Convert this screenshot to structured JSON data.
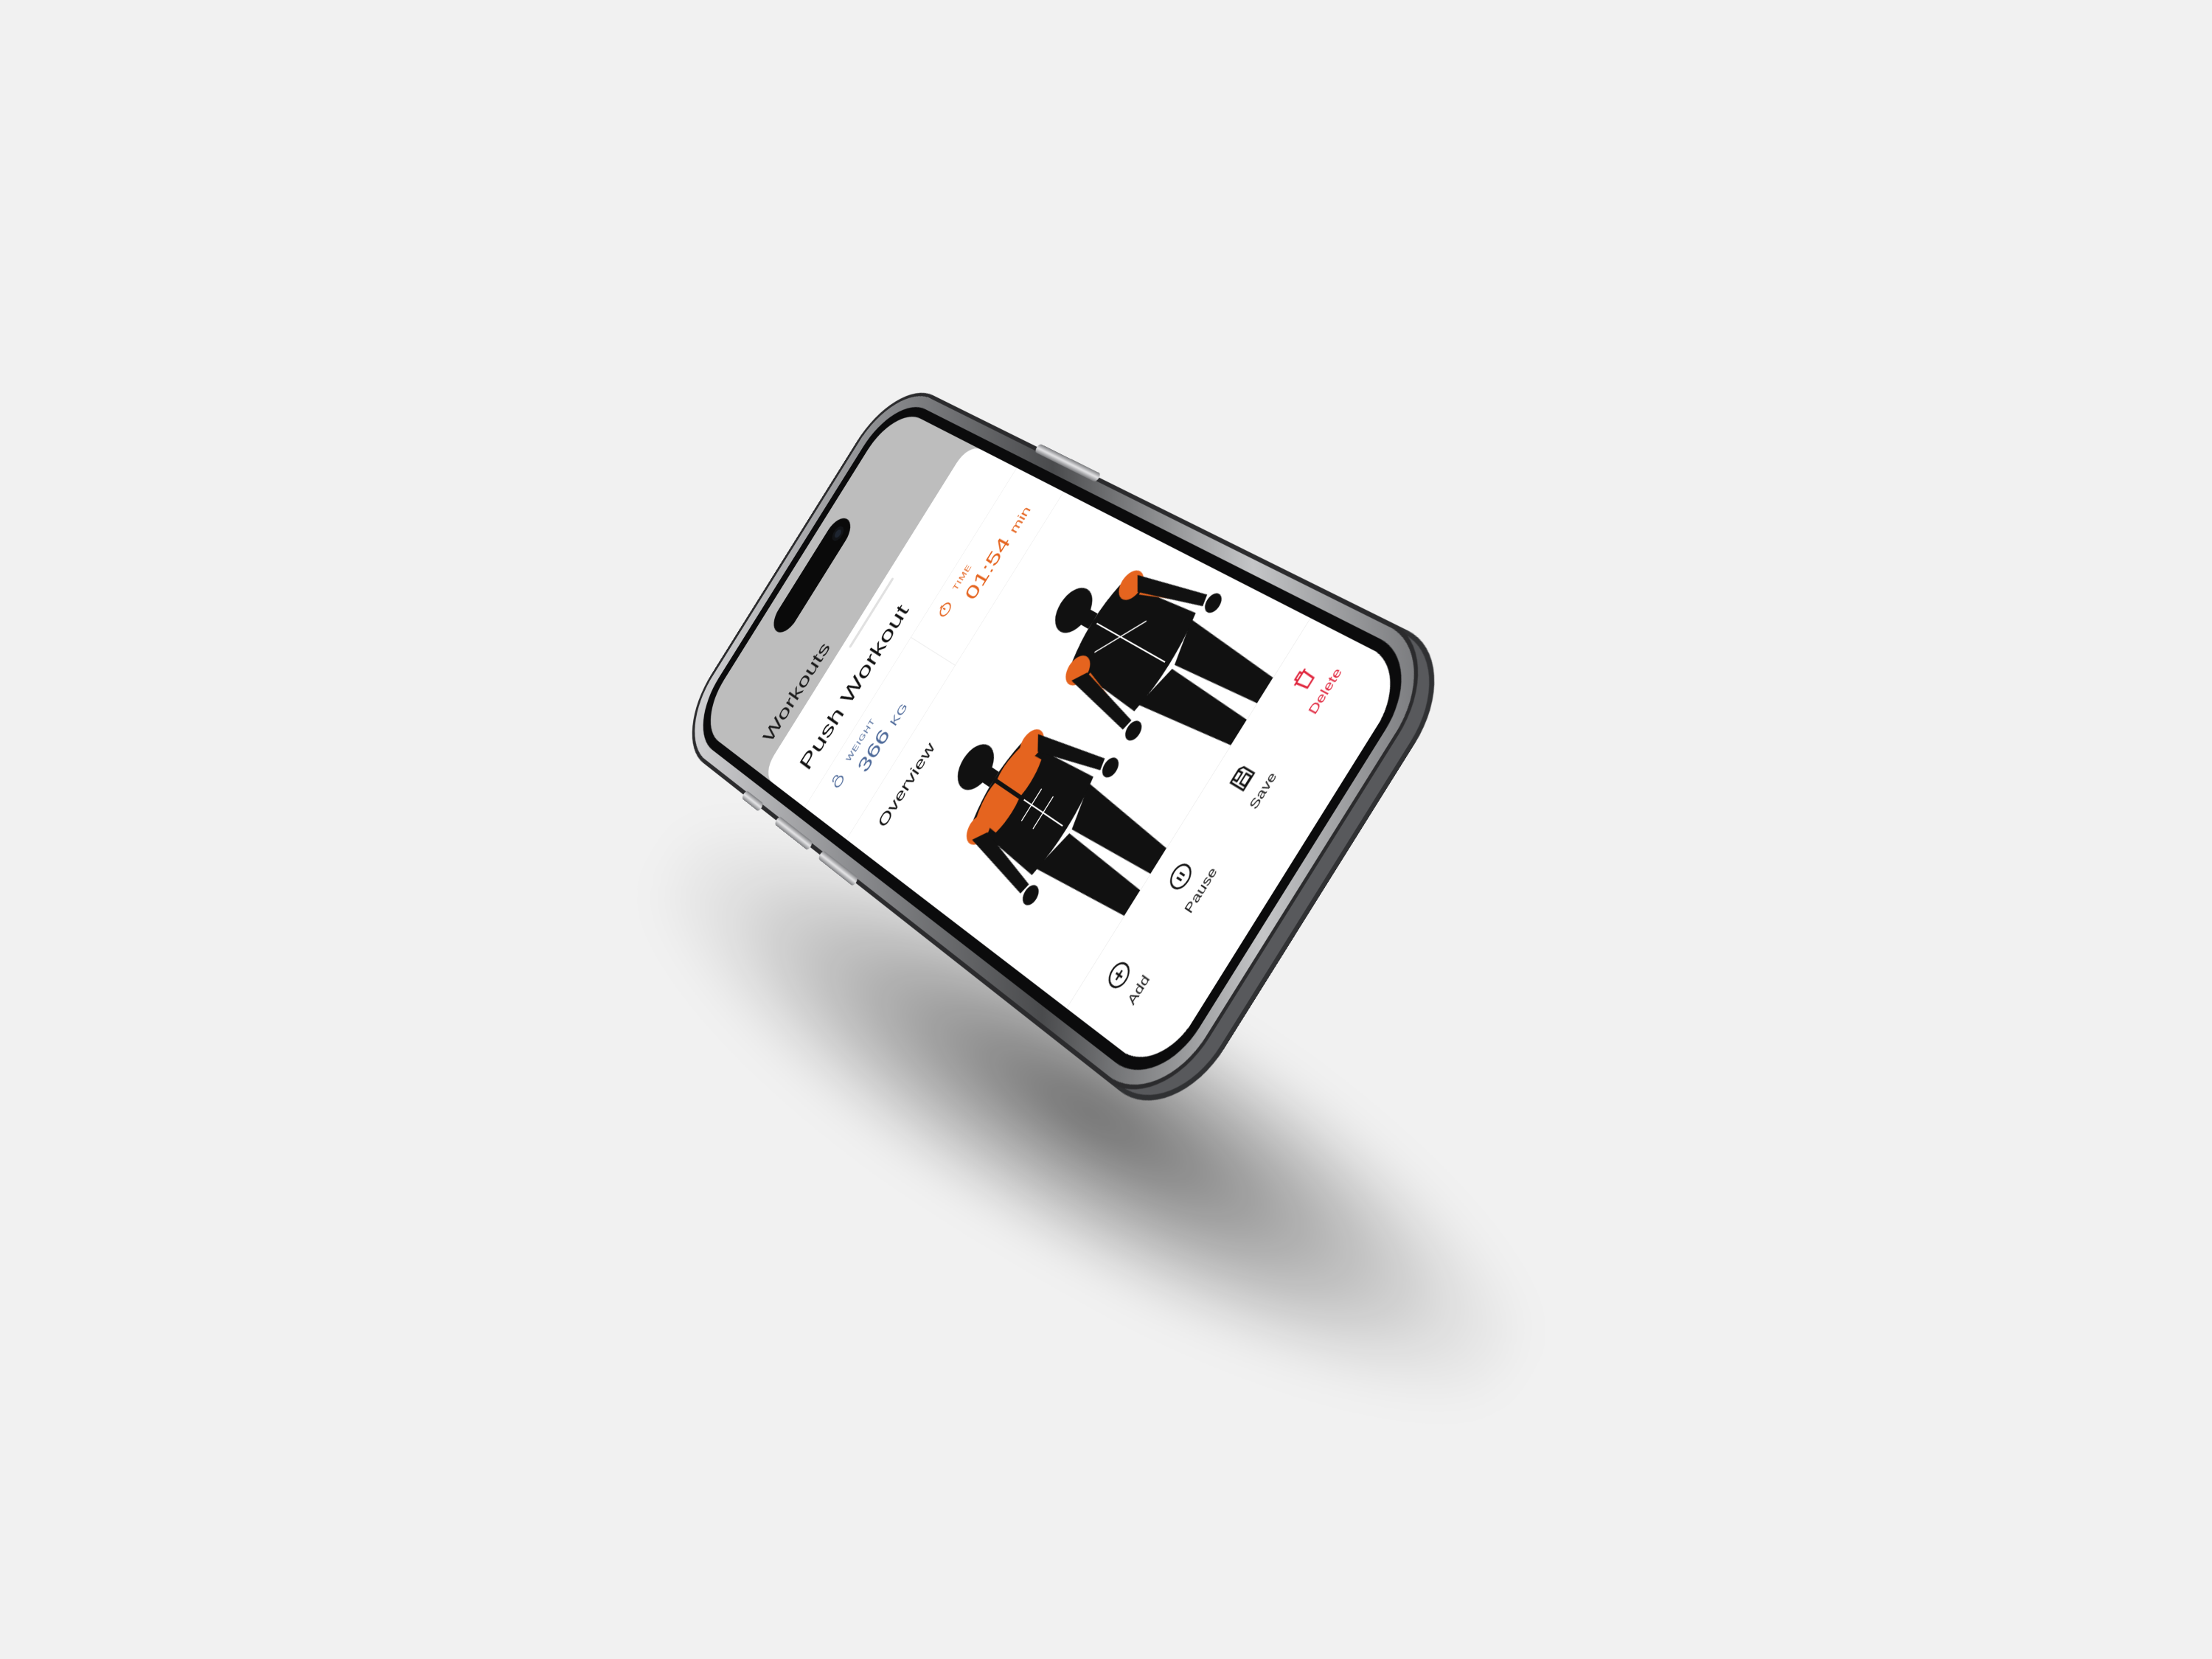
{
  "header": {
    "title": "Workouts"
  },
  "workout": {
    "title": "Push Workout",
    "weight": {
      "label": "WEIGHT",
      "value": "366",
      "unit": "KG",
      "icon": "kettlebell-icon"
    },
    "time": {
      "label": "TIME",
      "value": "01:54",
      "unit": "min",
      "icon": "stopwatch-icon"
    },
    "section_title": "Overview"
  },
  "tabbar": {
    "items": [
      {
        "label": "Add",
        "icon": "plus-circle-icon"
      },
      {
        "label": "Pause",
        "icon": "pause-circle-icon"
      },
      {
        "label": "Save",
        "icon": "floppy-disk-icon"
      },
      {
        "label": "Delete",
        "icon": "trash-icon"
      }
    ]
  },
  "colors": {
    "accent": "#e5641f",
    "weight": "#4e6a9a",
    "delete": "#e0243c",
    "muscle_highlight": "#e5641f"
  }
}
